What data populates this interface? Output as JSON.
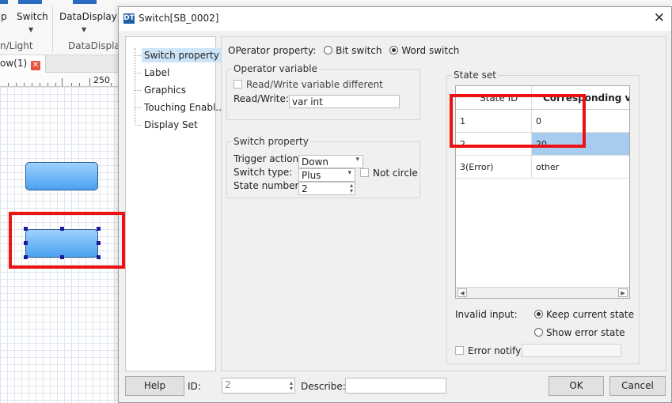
{
  "ribbon": {
    "labels": [
      "p",
      "Switch",
      "DataDisplay"
    ],
    "groups": [
      "n/Light",
      "DataDisplay"
    ]
  },
  "tab": {
    "label": "ow(1)",
    "close_glyph": "✕"
  },
  "ruler": {
    "label": "250"
  },
  "dialog": {
    "app_icon": "DT",
    "title": "Switch[SB_0002]",
    "close_glyph": "✕"
  },
  "nav": {
    "items": [
      "Switch property",
      "Label",
      "Graphics",
      "Touching Enabl...",
      "Display Set"
    ],
    "selected_index": 0
  },
  "operator": {
    "label": "OPerator property:",
    "options": [
      "Bit switch",
      "Word switch"
    ],
    "selected": "Word switch"
  },
  "operator_variable": {
    "title": "Operator variable",
    "rw_different_label": "Read/Write variable different",
    "rw_label": "Read/Write:",
    "rw_value": "var int"
  },
  "switch_property": {
    "title": "Switch property",
    "trigger_label": "Trigger action",
    "trigger_value": "Down",
    "type_label": "Switch type:",
    "type_value": "Plus",
    "not_circle_label": "Not circle",
    "state_number_label": "State number",
    "state_number_value": "2"
  },
  "state_set": {
    "title": "State set",
    "headers": [
      "State ID",
      "Corresponding value"
    ],
    "rows": [
      {
        "id": "1",
        "value": "0"
      },
      {
        "id": "2",
        "value": "20"
      },
      {
        "id": "3(Error)",
        "value": "other"
      }
    ],
    "selected_row": 1,
    "invalid_input_label": "Invalid input:",
    "invalid_options": [
      "Keep current state",
      "Show error state"
    ],
    "invalid_selected": "Keep current state",
    "error_notify_label": "Error notify"
  },
  "footer": {
    "help_label": "Help",
    "id_label": "ID:",
    "id_value": "2",
    "describe_label": "Describe:",
    "ok_label": "OK",
    "cancel_label": "Cancel"
  },
  "colors": {
    "highlight_box": "#ee1111",
    "selected_row": "#a8ccf0",
    "nav_selected": "#cce4f7"
  }
}
